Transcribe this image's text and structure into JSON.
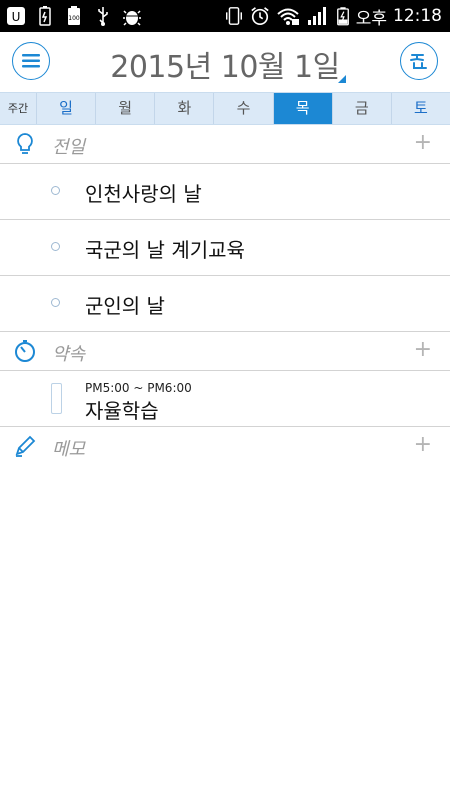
{
  "status_bar": {
    "ampm": "오후",
    "time": "12:18",
    "icons_left": [
      "cellular-app-icon",
      "battery-saver-icon",
      "battery-100-icon",
      "usb-icon",
      "debug-icon"
    ],
    "icons_right": [
      "vibrate-icon",
      "alarm-icon",
      "wifi-icon",
      "signal-icon",
      "battery-charging-icon"
    ]
  },
  "header": {
    "date": "2015년 10월 1일",
    "menu_icon": "menu-icon",
    "today_icon": "today-icon"
  },
  "week": {
    "label": "주간",
    "days": [
      "일",
      "월",
      "화",
      "수",
      "목",
      "금",
      "토"
    ],
    "selected_index": 4
  },
  "sections": {
    "events": {
      "title": "전일",
      "add": "+",
      "items": [
        "인천사랑의 날",
        "국군의 날 계기교육",
        "군인의 날"
      ]
    },
    "appointments": {
      "title": "약속",
      "add": "+",
      "items": [
        {
          "time": "PM5:00 ~ PM6:00",
          "title": "자율학습"
        }
      ]
    },
    "memo": {
      "title": "메모",
      "add": "+"
    }
  },
  "colors": {
    "accent": "#1c88d4",
    "week_bg": "#dbe9f7",
    "section_title": "#9a9a9a"
  }
}
